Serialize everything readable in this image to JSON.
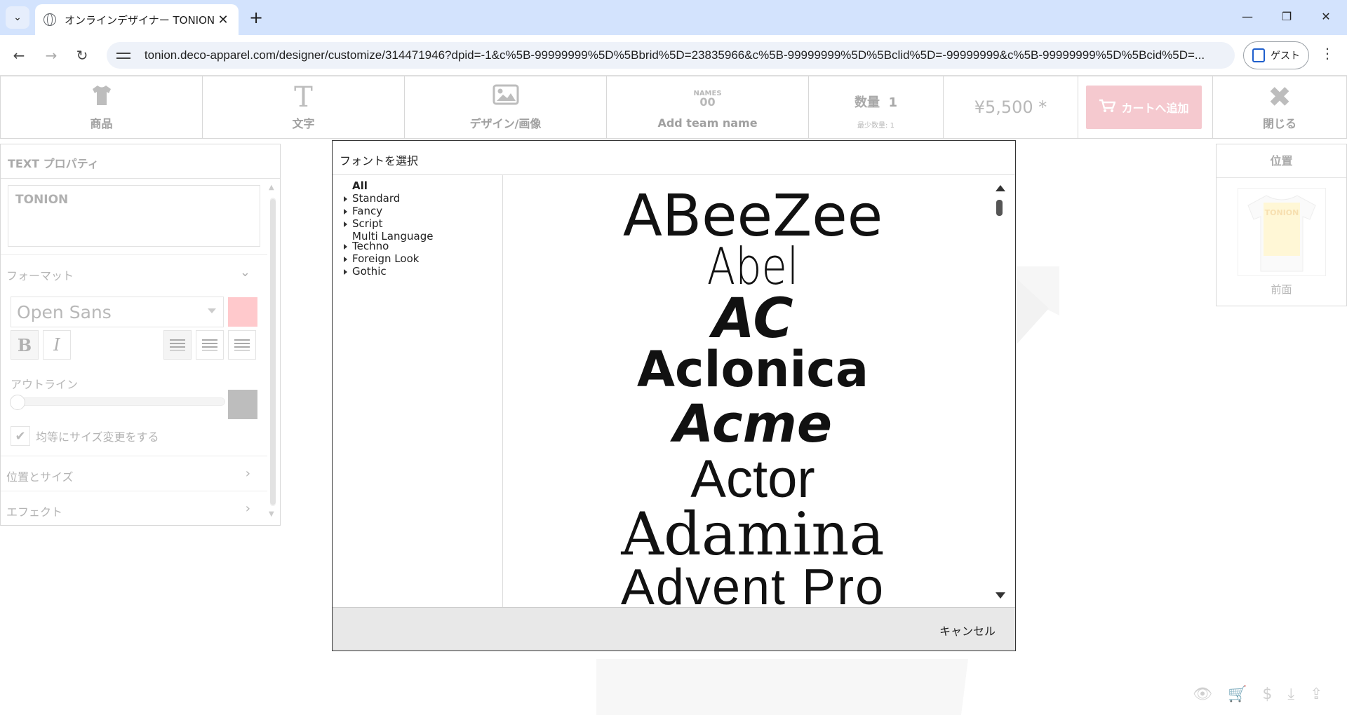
{
  "browser": {
    "tab_title": "オンラインデザイナー TONION",
    "url": "tonion.deco-apparel.com/designer/customize/314471946?dpid=-1&c%5B-99999999%5D%5Bbrid%5D=23835966&c%5B-99999999%5D%5Bclid%5D=-99999999&c%5B-99999999%5D%5Bcid%5D=...",
    "guest_label": "ゲスト",
    "icons": [
      "tab-search-icon",
      "globe-icon",
      "close-icon",
      "plus-icon",
      "minimize-icon",
      "restore-icon",
      "close-window-icon",
      "back-icon",
      "forward-icon",
      "reload-icon",
      "site-info-icon",
      "guest-icon",
      "more-icon"
    ]
  },
  "toolbar": {
    "product_label": "商品",
    "text_label": "文字",
    "design_label": "デザイン/画像",
    "team_badge": "NAMES\n00",
    "team_label": "Add team name",
    "qty_label": "数量",
    "qty_value": "1",
    "qty_min": "最少数量: 1",
    "price": "¥5,500 *",
    "cart_label": "カートへ追加",
    "close_label": "閉じる"
  },
  "props": {
    "header": "TEXT プロパティ",
    "text_value": "TONION",
    "format_label": "フォーマット",
    "font_value": "Open Sans",
    "text_color": "#ffc9cc",
    "outline_label": "アウトライン",
    "outline_color": "#bdbdbd",
    "outline_value": 0,
    "uniform_resize_label": "均等にサイズ変更をする",
    "uniform_resize_checked": true,
    "position_size_label": "位置とサイズ",
    "effect_label": "エフェクト"
  },
  "position_panel": {
    "header": "位置",
    "front_label": "前面",
    "thumb_text": "TONION"
  },
  "modal": {
    "title": "フォントを選択",
    "categories": [
      {
        "label": "All",
        "selected": true,
        "expandable": false
      },
      {
        "label": "Standard",
        "selected": false,
        "expandable": true
      },
      {
        "label": "Fancy",
        "selected": false,
        "expandable": true
      },
      {
        "label": "Script",
        "selected": false,
        "expandable": true
      },
      {
        "label": "Multi Language",
        "selected": false,
        "expandable": false
      },
      {
        "label": "Techno",
        "selected": false,
        "expandable": true
      },
      {
        "label": "Foreign Look",
        "selected": false,
        "expandable": true
      },
      {
        "label": "Gothic",
        "selected": false,
        "expandable": true
      }
    ],
    "fonts": [
      "ABeeZee",
      "Abel",
      "AC",
      "Aclonica",
      "Acme",
      "Actor",
      "Adamina",
      "Advent Pro"
    ],
    "cancel_label": "キャンセル"
  },
  "bottom_icons": [
    "eye-icon",
    "cart-icon",
    "dollar-icon",
    "download-icon",
    "share-icon"
  ]
}
